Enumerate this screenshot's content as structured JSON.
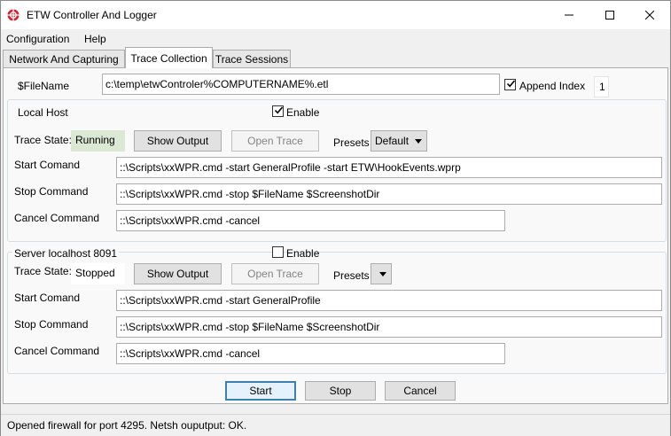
{
  "window": {
    "title": "ETW Controller And Logger",
    "minimize": "—",
    "maximize": "☐",
    "close": "✕"
  },
  "menu": [
    "Configuration",
    "Help"
  ],
  "tabs": [
    "Network And Capturing",
    "Trace Collection",
    "Trace Sessions"
  ],
  "filename": {
    "label": "$FileName",
    "value": "c:\\temp\\etwControler%COMPUTERNAME%.etl",
    "append_label": "Append Index",
    "append_checked": true,
    "index_value": "1"
  },
  "local": {
    "title": "Local Host",
    "enable_label": "Enable",
    "enabled": true,
    "trace_state_label": "Trace State:",
    "trace_state": "Running",
    "show_output": "Show Output",
    "open_trace": "Open Trace",
    "presets_label": "Presets",
    "preset_value": "Default",
    "start_label": "Start Comand",
    "start_value": "::\\Scripts\\xxWPR.cmd -start GeneralProfile  -start ETW\\HookEvents.wprp",
    "stop_label": "Stop Command",
    "stop_value": "::\\Scripts\\xxWPR.cmd -stop $FileName $ScreenshotDir",
    "cancel_label": "Cancel Command",
    "cancel_value": "::\\Scripts\\xxWPR.cmd -cancel"
  },
  "server": {
    "title": "Server  localhost  8091",
    "enable_label": "Enable",
    "enabled": false,
    "trace_state_label": "Trace State:",
    "trace_state": "Stopped",
    "show_output": "Show Output",
    "open_trace": "Open Trace",
    "presets_label": "Presets",
    "preset_value": "",
    "start_label": "Start Comand",
    "start_value": "::\\Scripts\\xxWPR.cmd -start GeneralProfile",
    "stop_label": "Stop Command",
    "stop_value": "::\\Scripts\\xxWPR.cmd -stop $FileName  $ScreenshotDir",
    "cancel_label": "Cancel Command",
    "cancel_value": "::\\Scripts\\xxWPR.cmd -cancel"
  },
  "actions": {
    "start": "Start",
    "stop": "Stop",
    "cancel": "Cancel"
  },
  "status": {
    "text": "Opened firewall for port 4295. Netsh ouputput: OK."
  },
  "colors": {
    "running_bg": "#dbe8d4",
    "accent": "#3c7fb1",
    "icon_red": "#d3232f"
  }
}
